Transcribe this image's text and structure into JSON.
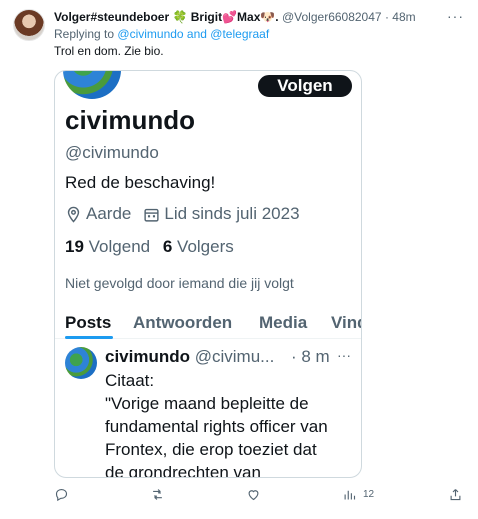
{
  "tweet": {
    "display_name": "Volger#steundeboer 🍀 Brigit💕Max🐶.",
    "handle": "@Volger66082047",
    "dot": "·",
    "time": "48m",
    "more_icon": "···",
    "replying_prefix": "Replying to",
    "replying_to": "@civimundo and @telegraaf",
    "text": "Trol en dom. Zie bio."
  },
  "card": {
    "follow_label": "Volgen",
    "name": "civimundo",
    "handle": "@civimundo",
    "bio": "Red de beschaving!",
    "location": "Aarde",
    "joined": "Lid sinds juli 2023",
    "following_count": "19",
    "following_label": "Volgend",
    "followers_count": "6",
    "followers_label": "Volgers",
    "not_followed": "Niet gevolgd door iemand die jij volgt",
    "tabs": [
      "Posts",
      "Antwoorden",
      "Media",
      "Vind-ik-leuks"
    ],
    "inner_post": {
      "name": "civimundo",
      "handle": "@civimu...",
      "time": "· 8 m",
      "more_icon": "···",
      "lines": [
        "Citaat:",
        "\"Vorige maand bepleitte de",
        "fundamental rights officer van",
        "Frontex, die erop toeziet dat",
        "de grondrechten van"
      ]
    }
  },
  "actions": {
    "reply_icon": "reply-icon",
    "repost_icon": "repost-icon",
    "like_icon": "like-icon",
    "views_icon": "views-icon",
    "views_count": "12",
    "share_icon": "share-icon"
  },
  "colors": {
    "accent": "#1d9bf0",
    "text": "#0f1419",
    "muted": "#536471",
    "border": "#cfd9de"
  }
}
